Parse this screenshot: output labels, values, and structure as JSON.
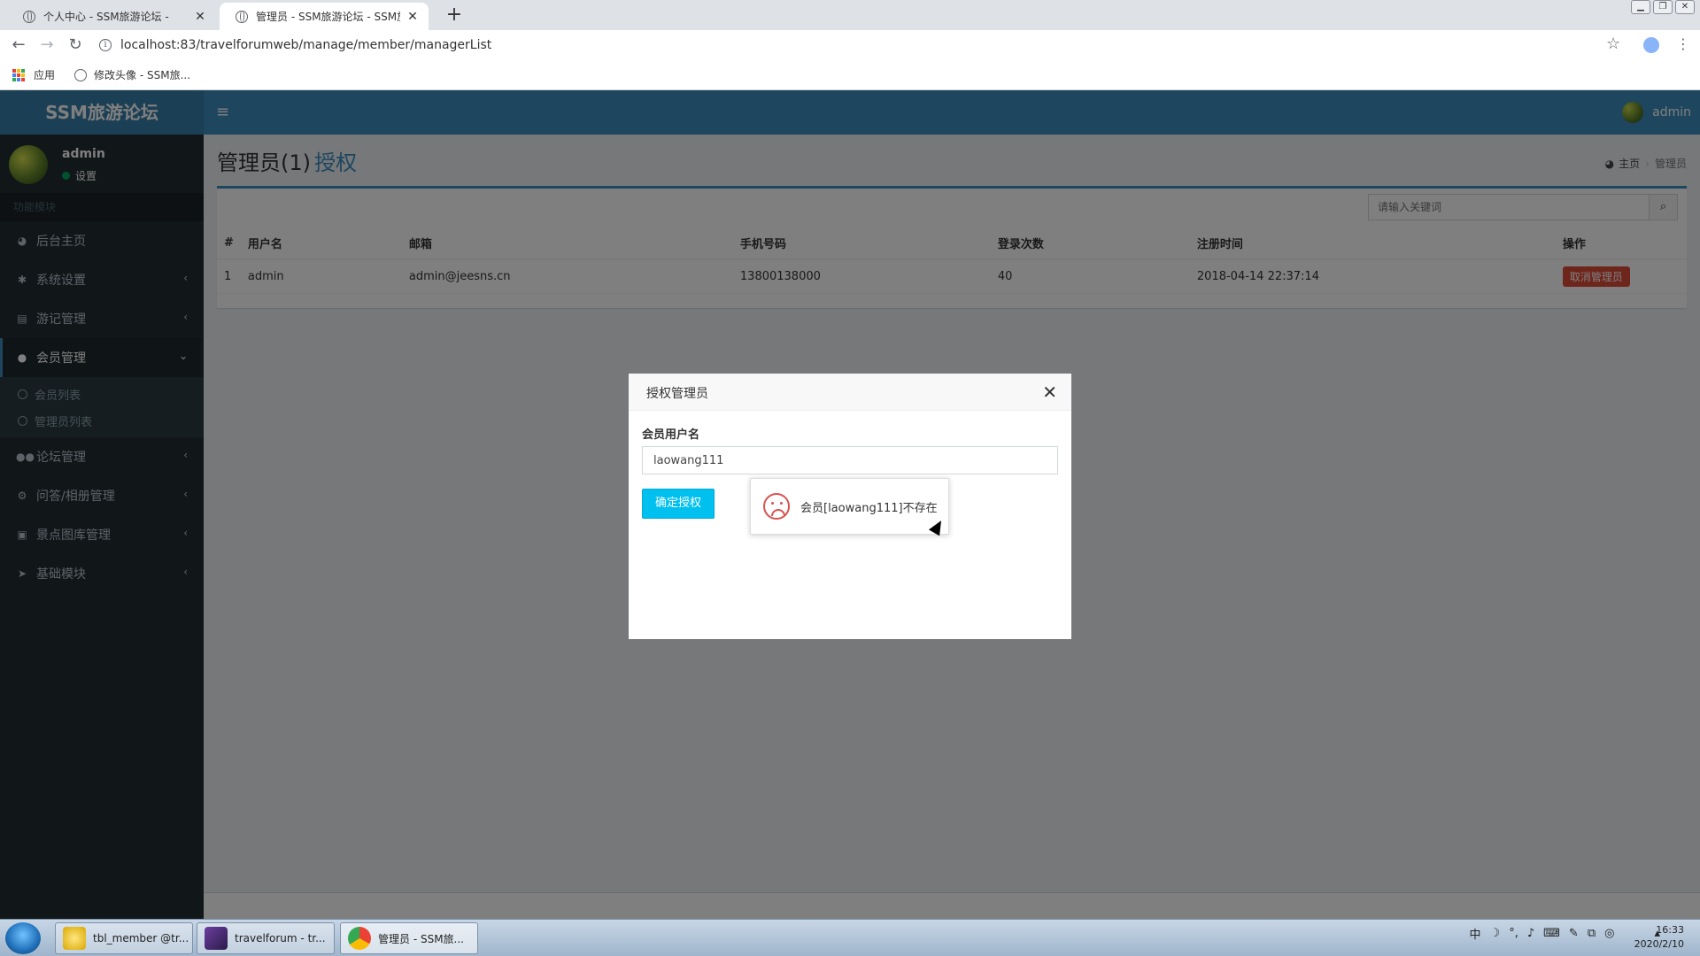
{
  "browser": {
    "tabs": [
      {
        "title": "个人中心 - SSM旅游论坛 -",
        "active": false
      },
      {
        "title": "管理员 - SSM旅游论坛 - SSM旅",
        "active": true
      }
    ],
    "url": "localhost:83/travelforumweb/manage/member/managerList",
    "bookmarks": [
      {
        "label": "应用"
      },
      {
        "label": "修改头像 - SSM旅..."
      }
    ]
  },
  "header": {
    "logo": "SSM旅游论坛",
    "username": "admin"
  },
  "sidebar": {
    "user_name": "admin",
    "user_status": "设置",
    "section_header": "功能模块",
    "items": [
      {
        "label": "后台主页",
        "icon": "dashboard-icon"
      },
      {
        "label": "系统设置",
        "icon": "gear-icon"
      },
      {
        "label": "游记管理",
        "icon": "book-icon"
      },
      {
        "label": "会员管理",
        "icon": "user-icon"
      },
      {
        "label": "论坛管理",
        "icon": "users-icon"
      },
      {
        "label": "问答/相册管理",
        "icon": "cogs-icon"
      },
      {
        "label": "景点图库管理",
        "icon": "image-icon"
      },
      {
        "label": "基础模块",
        "icon": "send-icon"
      }
    ],
    "subitems": [
      {
        "label": "会员列表"
      },
      {
        "label": "管理员列表"
      }
    ]
  },
  "page": {
    "title": "管理员(1)",
    "subtitle": "授权",
    "breadcrumb": {
      "home": "主页",
      "current": "管理员"
    }
  },
  "search": {
    "placeholder": "请输入关键词"
  },
  "table": {
    "headers": [
      "#",
      "用户名",
      "邮箱",
      "手机号码",
      "登录次数",
      "注册时间",
      "操作"
    ],
    "rows": [
      {
        "index": "1",
        "username": "admin",
        "email": "admin@jeesns.cn",
        "phone": "13800138000",
        "logins": "40",
        "registered": "2018-04-14 22:37:14",
        "action": "取消管理员"
      }
    ]
  },
  "modal": {
    "title": "授权管理员",
    "field_label": "会员用户名",
    "field_value": "laowang111",
    "confirm_label": "确定授权"
  },
  "toast": {
    "message": "会员[laowang111]不存在"
  },
  "taskbar": {
    "items": [
      {
        "label": "tbl_member @tr..."
      },
      {
        "label": "travelforum - tr..."
      },
      {
        "label": "管理员 - SSM旅..."
      }
    ],
    "tray": [
      "中"
    ],
    "time": "16:33",
    "date": "2020/2/10"
  },
  "colors": {
    "header": "#3c8dbc",
    "logo_bg": "#367fa9",
    "sidebar": "#222d32",
    "danger": "#dd4b39",
    "info_button": "#00c0ef"
  }
}
